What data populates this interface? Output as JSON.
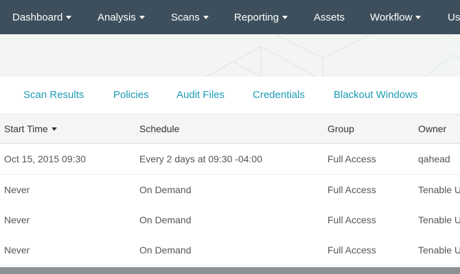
{
  "nav": {
    "items": [
      {
        "label": "Dashboard",
        "dropdown": true
      },
      {
        "label": "Analysis",
        "dropdown": true
      },
      {
        "label": "Scans",
        "dropdown": true
      },
      {
        "label": "Reporting",
        "dropdown": true
      },
      {
        "label": "Assets",
        "dropdown": false
      },
      {
        "label": "Workflow",
        "dropdown": true
      },
      {
        "label": "Us",
        "dropdown": false
      }
    ]
  },
  "tabs": [
    "Scan Results",
    "Policies",
    "Audit Files",
    "Credentials",
    "Blackout Windows"
  ],
  "table": {
    "columns": [
      "Start Time",
      "Schedule",
      "Group",
      "Owner"
    ],
    "sort_column": "Start Time",
    "rows": [
      [
        "Oct 15, 2015 09:30",
        "Every 2 days at 09:30 -04:00",
        "Full Access",
        "qahead"
      ],
      [
        "Never",
        "On Demand",
        "Full Access",
        "Tenable U"
      ],
      [
        "Never",
        "On Demand",
        "Full Access",
        "Tenable U"
      ],
      [
        "Never",
        "On Demand",
        "Full Access",
        "Tenable U"
      ]
    ]
  },
  "colors": {
    "navbar": "#3d4f5c",
    "tab_link": "#1b9bb4",
    "banner": "#f3f4f4",
    "header_row": "#f5f5f5"
  },
  "icons": {
    "dropdown": "caret-down-icon",
    "sort": "sort-caret-icon"
  }
}
